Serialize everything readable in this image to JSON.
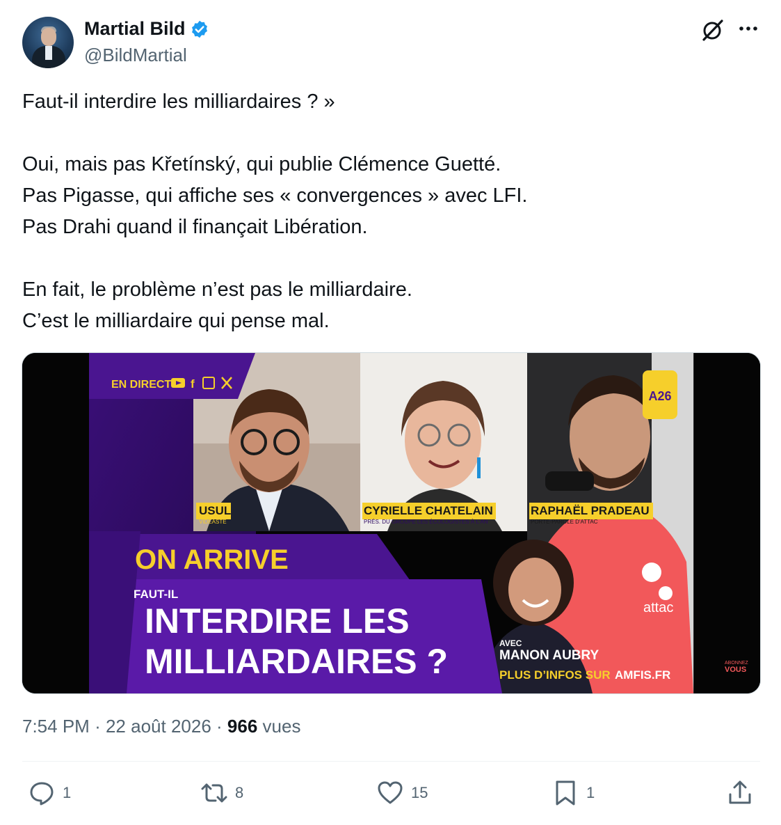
{
  "author": {
    "name": "Martial Bild",
    "handle": "@BildMartial",
    "verified_color": "#1d9bf0"
  },
  "tweet": {
    "lines": [
      "Faut-il interdire les milliardaires ? »",
      "",
      "Oui, mais pas Křetínský, qui publie Clémence Guetté.",
      "Pas Pigasse, qui affiche ses « convergences » avec LFI.",
      "Pas Drahi quand il finançait Libération.",
      "",
      "En fait, le problème n’est pas le milliardaire.",
      "C’est le milliardaire qui pense mal."
    ]
  },
  "media": {
    "live_label": "EN DIRECT",
    "logo_text": "A26",
    "speakers": [
      {
        "name": "USUL",
        "role": "VIDÉASTE"
      },
      {
        "name": "CYRIELLE CHATELAIN",
        "role": "PRÉS. DU GROUPE LES ÉCOLOGISTES À L'AN"
      },
      {
        "name": "RAPHAËL PRADEAU",
        "role": "PORTE-PAROLE D'ATTAC"
      }
    ],
    "on_arrive": "ON ARRIVE",
    "question_prefix": "FAUT-IL",
    "question_line1": "INTERDIRE LES",
    "question_line2": "MILLIARDAIRES ?",
    "avec_label": "AVEC",
    "guest_name": "MANON AUBRY",
    "infos_prefix": "PLUS D’INFOS SUR",
    "infos_site": "AMFIS.FR",
    "shirt_text": "attac",
    "subscribe_line1": "ABONNEZ",
    "subscribe_line2": "VOUS",
    "colors": {
      "purple": "#4a1590",
      "deep_purple": "#2e0a60",
      "yellow": "#f6cf2b"
    }
  },
  "meta": {
    "time": "7:54 PM",
    "sep": "·",
    "date": "22 août 2026",
    "views_count": "966",
    "views_label": "vues"
  },
  "actions": {
    "replies": "1",
    "reposts": "8",
    "likes": "15",
    "bookmarks": "1"
  }
}
